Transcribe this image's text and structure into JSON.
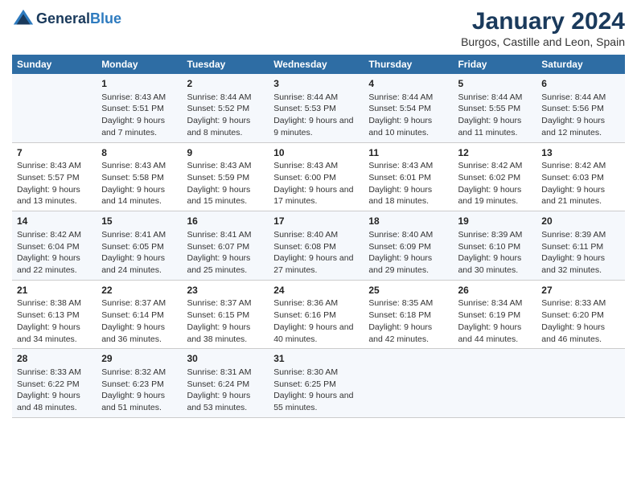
{
  "header": {
    "logo_line1": "General",
    "logo_line2": "Blue",
    "title": "January 2024",
    "subtitle": "Burgos, Castille and Leon, Spain"
  },
  "weekdays": [
    "Sunday",
    "Monday",
    "Tuesday",
    "Wednesday",
    "Thursday",
    "Friday",
    "Saturday"
  ],
  "weeks": [
    [
      {
        "day": "",
        "sunrise": "",
        "sunset": "",
        "daylight": ""
      },
      {
        "day": "1",
        "sunrise": "Sunrise: 8:43 AM",
        "sunset": "Sunset: 5:51 PM",
        "daylight": "Daylight: 9 hours and 7 minutes."
      },
      {
        "day": "2",
        "sunrise": "Sunrise: 8:44 AM",
        "sunset": "Sunset: 5:52 PM",
        "daylight": "Daylight: 9 hours and 8 minutes."
      },
      {
        "day": "3",
        "sunrise": "Sunrise: 8:44 AM",
        "sunset": "Sunset: 5:53 PM",
        "daylight": "Daylight: 9 hours and 9 minutes."
      },
      {
        "day": "4",
        "sunrise": "Sunrise: 8:44 AM",
        "sunset": "Sunset: 5:54 PM",
        "daylight": "Daylight: 9 hours and 10 minutes."
      },
      {
        "day": "5",
        "sunrise": "Sunrise: 8:44 AM",
        "sunset": "Sunset: 5:55 PM",
        "daylight": "Daylight: 9 hours and 11 minutes."
      },
      {
        "day": "6",
        "sunrise": "Sunrise: 8:44 AM",
        "sunset": "Sunset: 5:56 PM",
        "daylight": "Daylight: 9 hours and 12 minutes."
      }
    ],
    [
      {
        "day": "7",
        "sunrise": "Sunrise: 8:43 AM",
        "sunset": "Sunset: 5:57 PM",
        "daylight": "Daylight: 9 hours and 13 minutes."
      },
      {
        "day": "8",
        "sunrise": "Sunrise: 8:43 AM",
        "sunset": "Sunset: 5:58 PM",
        "daylight": "Daylight: 9 hours and 14 minutes."
      },
      {
        "day": "9",
        "sunrise": "Sunrise: 8:43 AM",
        "sunset": "Sunset: 5:59 PM",
        "daylight": "Daylight: 9 hours and 15 minutes."
      },
      {
        "day": "10",
        "sunrise": "Sunrise: 8:43 AM",
        "sunset": "Sunset: 6:00 PM",
        "daylight": "Daylight: 9 hours and 17 minutes."
      },
      {
        "day": "11",
        "sunrise": "Sunrise: 8:43 AM",
        "sunset": "Sunset: 6:01 PM",
        "daylight": "Daylight: 9 hours and 18 minutes."
      },
      {
        "day": "12",
        "sunrise": "Sunrise: 8:42 AM",
        "sunset": "Sunset: 6:02 PM",
        "daylight": "Daylight: 9 hours and 19 minutes."
      },
      {
        "day": "13",
        "sunrise": "Sunrise: 8:42 AM",
        "sunset": "Sunset: 6:03 PM",
        "daylight": "Daylight: 9 hours and 21 minutes."
      }
    ],
    [
      {
        "day": "14",
        "sunrise": "Sunrise: 8:42 AM",
        "sunset": "Sunset: 6:04 PM",
        "daylight": "Daylight: 9 hours and 22 minutes."
      },
      {
        "day": "15",
        "sunrise": "Sunrise: 8:41 AM",
        "sunset": "Sunset: 6:05 PM",
        "daylight": "Daylight: 9 hours and 24 minutes."
      },
      {
        "day": "16",
        "sunrise": "Sunrise: 8:41 AM",
        "sunset": "Sunset: 6:07 PM",
        "daylight": "Daylight: 9 hours and 25 minutes."
      },
      {
        "day": "17",
        "sunrise": "Sunrise: 8:40 AM",
        "sunset": "Sunset: 6:08 PM",
        "daylight": "Daylight: 9 hours and 27 minutes."
      },
      {
        "day": "18",
        "sunrise": "Sunrise: 8:40 AM",
        "sunset": "Sunset: 6:09 PM",
        "daylight": "Daylight: 9 hours and 29 minutes."
      },
      {
        "day": "19",
        "sunrise": "Sunrise: 8:39 AM",
        "sunset": "Sunset: 6:10 PM",
        "daylight": "Daylight: 9 hours and 30 minutes."
      },
      {
        "day": "20",
        "sunrise": "Sunrise: 8:39 AM",
        "sunset": "Sunset: 6:11 PM",
        "daylight": "Daylight: 9 hours and 32 minutes."
      }
    ],
    [
      {
        "day": "21",
        "sunrise": "Sunrise: 8:38 AM",
        "sunset": "Sunset: 6:13 PM",
        "daylight": "Daylight: 9 hours and 34 minutes."
      },
      {
        "day": "22",
        "sunrise": "Sunrise: 8:37 AM",
        "sunset": "Sunset: 6:14 PM",
        "daylight": "Daylight: 9 hours and 36 minutes."
      },
      {
        "day": "23",
        "sunrise": "Sunrise: 8:37 AM",
        "sunset": "Sunset: 6:15 PM",
        "daylight": "Daylight: 9 hours and 38 minutes."
      },
      {
        "day": "24",
        "sunrise": "Sunrise: 8:36 AM",
        "sunset": "Sunset: 6:16 PM",
        "daylight": "Daylight: 9 hours and 40 minutes."
      },
      {
        "day": "25",
        "sunrise": "Sunrise: 8:35 AM",
        "sunset": "Sunset: 6:18 PM",
        "daylight": "Daylight: 9 hours and 42 minutes."
      },
      {
        "day": "26",
        "sunrise": "Sunrise: 8:34 AM",
        "sunset": "Sunset: 6:19 PM",
        "daylight": "Daylight: 9 hours and 44 minutes."
      },
      {
        "day": "27",
        "sunrise": "Sunrise: 8:33 AM",
        "sunset": "Sunset: 6:20 PM",
        "daylight": "Daylight: 9 hours and 46 minutes."
      }
    ],
    [
      {
        "day": "28",
        "sunrise": "Sunrise: 8:33 AM",
        "sunset": "Sunset: 6:22 PM",
        "daylight": "Daylight: 9 hours and 48 minutes."
      },
      {
        "day": "29",
        "sunrise": "Sunrise: 8:32 AM",
        "sunset": "Sunset: 6:23 PM",
        "daylight": "Daylight: 9 hours and 51 minutes."
      },
      {
        "day": "30",
        "sunrise": "Sunrise: 8:31 AM",
        "sunset": "Sunset: 6:24 PM",
        "daylight": "Daylight: 9 hours and 53 minutes."
      },
      {
        "day": "31",
        "sunrise": "Sunrise: 8:30 AM",
        "sunset": "Sunset: 6:25 PM",
        "daylight": "Daylight: 9 hours and 55 minutes."
      },
      {
        "day": "",
        "sunrise": "",
        "sunset": "",
        "daylight": ""
      },
      {
        "day": "",
        "sunrise": "",
        "sunset": "",
        "daylight": ""
      },
      {
        "day": "",
        "sunrise": "",
        "sunset": "",
        "daylight": ""
      }
    ]
  ]
}
